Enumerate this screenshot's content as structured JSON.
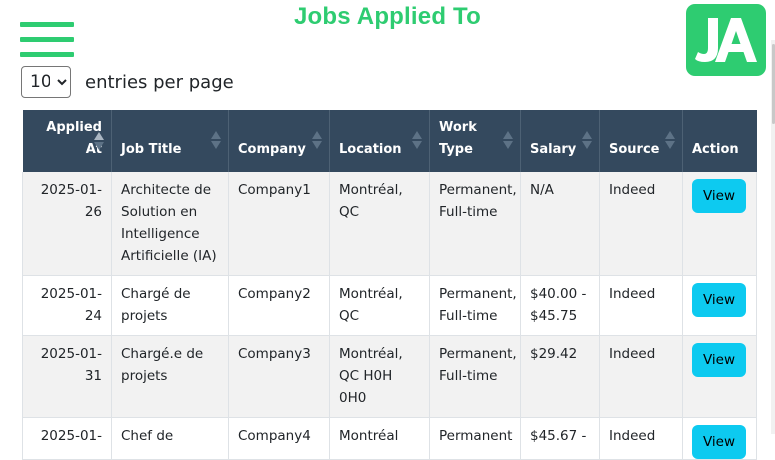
{
  "header": {
    "title": "Jobs Applied To",
    "logo_text": "JA",
    "menu_icon": "hamburger-menu-icon"
  },
  "colors": {
    "brand": "#2ecc71",
    "table_header": "#34495e",
    "view_button": "#0dcaf0"
  },
  "entries": {
    "selected": "10",
    "label": "entries per page"
  },
  "table": {
    "columns": [
      {
        "label": "Applied At",
        "sort": "ascending"
      },
      {
        "label": "Job Title",
        "sort": "none"
      },
      {
        "label": "Company",
        "sort": "none"
      },
      {
        "label": "Location",
        "sort": "none"
      },
      {
        "label": "Work Type",
        "sort": "none"
      },
      {
        "label": "Salary",
        "sort": "none"
      },
      {
        "label": "Source",
        "sort": "none"
      },
      {
        "label": "Action",
        "sort": "none"
      }
    ],
    "rows": [
      {
        "applied_at": "2025-01-26",
        "job_title": "Architecte de Solution en Intelligence Artificielle (IA)",
        "company": "Company1",
        "location": "Montréal, QC",
        "work_type": "Permanent, Full-time",
        "salary": "N/A",
        "source": "Indeed",
        "action": "View"
      },
      {
        "applied_at": "2025-01-24",
        "job_title": "Chargé de projets",
        "company": "Company2",
        "location": "Montréal, QC",
        "work_type": "Permanent, Full-time",
        "salary": "$40.00 - $45.75",
        "source": "Indeed",
        "action": "View"
      },
      {
        "applied_at": "2025-01-31",
        "job_title": "Chargé.e de projets",
        "company": "Company3",
        "location": "Montréal, QC H0H 0H0",
        "work_type": "Permanent, Full-time",
        "salary": "$29.42",
        "source": "Indeed",
        "action": "View"
      },
      {
        "applied_at": "2025-01-",
        "job_title": "Chef de",
        "company": "Company4",
        "location": "Montréal",
        "work_type": "Permanent",
        "salary": "$45.67 -",
        "source": "Indeed",
        "action": "View"
      }
    ]
  }
}
